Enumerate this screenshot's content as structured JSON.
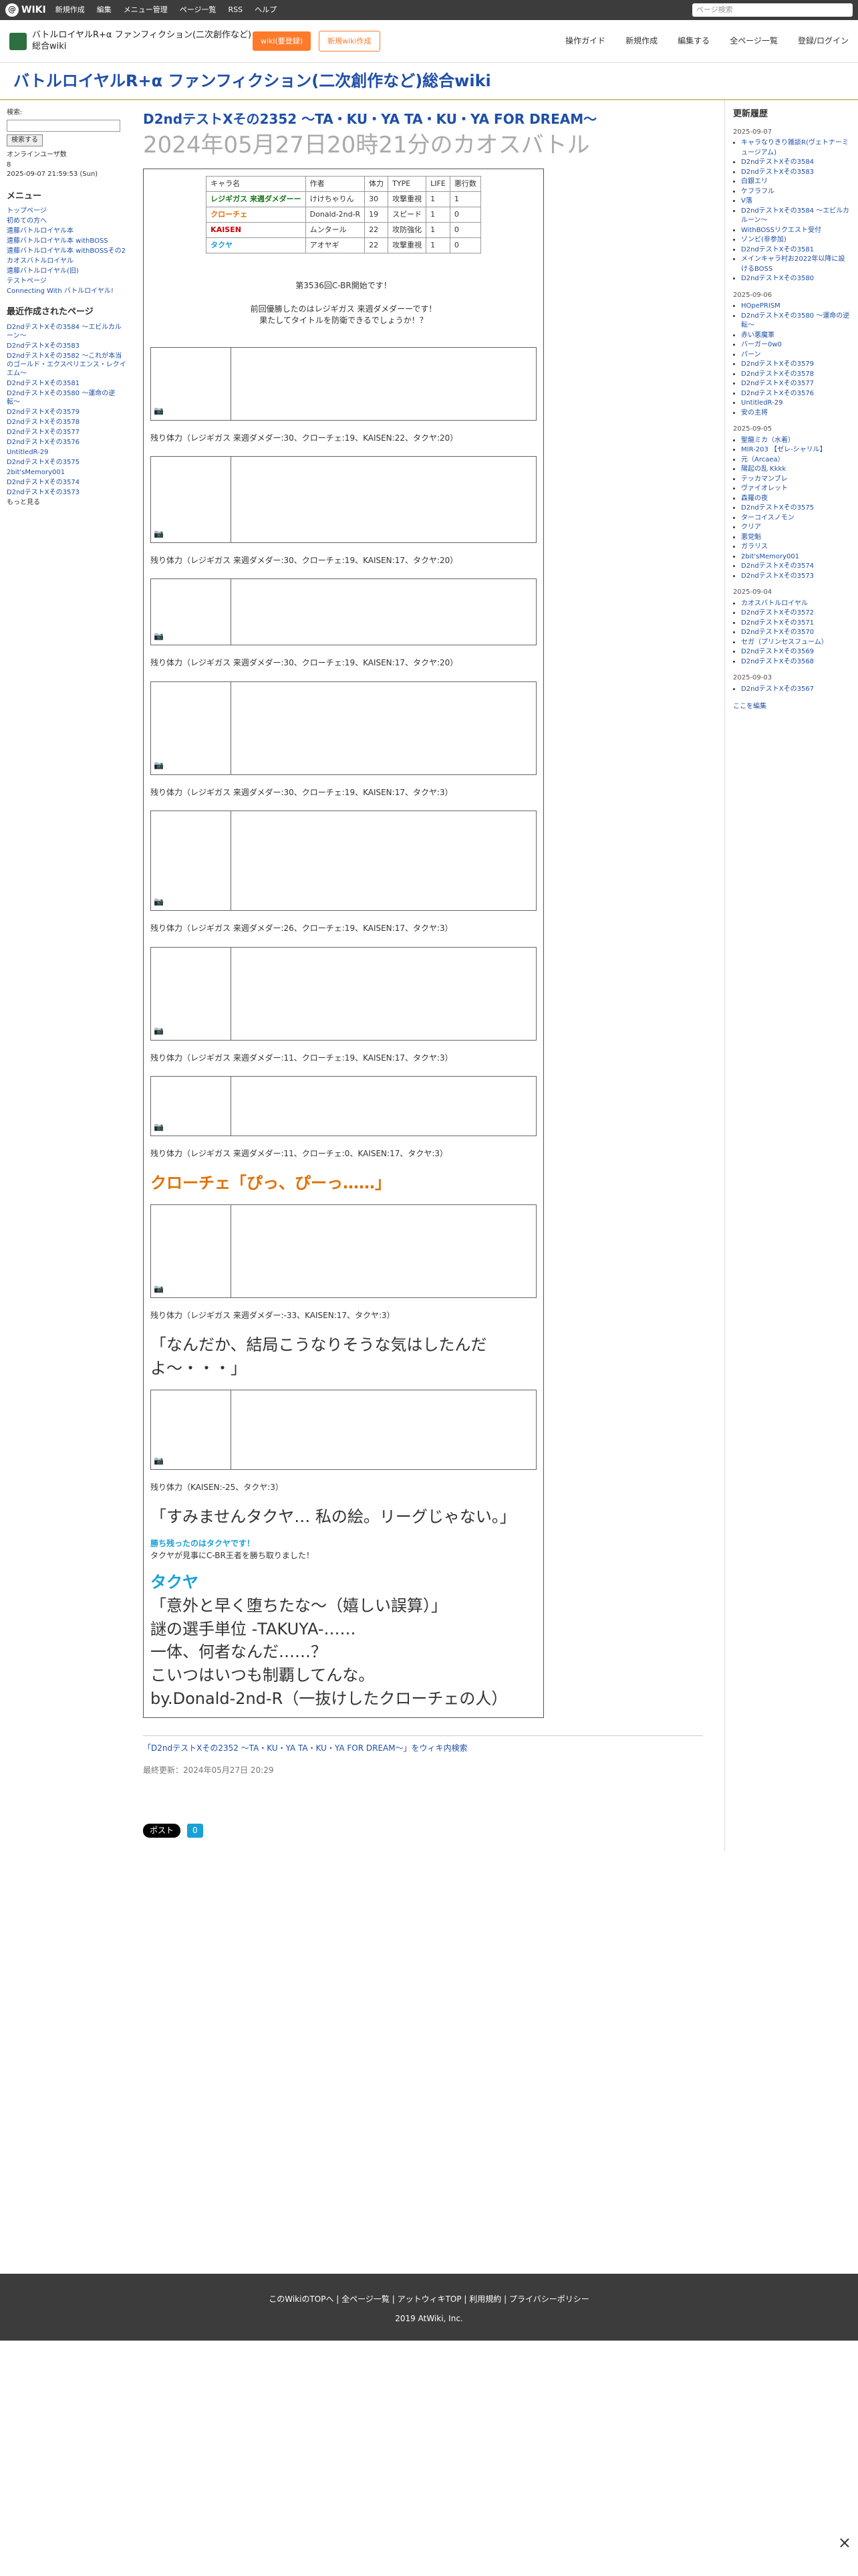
{
  "topbar": {
    "brand": "WIKI",
    "menu": [
      "新規作成",
      "編集",
      "メニュー管理",
      "ページ一覧",
      "RSS",
      "ヘルプ"
    ],
    "search_placeholder": "ページ検索"
  },
  "header": {
    "title": "バトルロイヤルR+α ファンフィクション(二次創作など)総合wiki",
    "btn_wiki": "wiki(要登録)",
    "btn_signup": "新規wiki作成",
    "nav": [
      "操作ガイド",
      "新規作成",
      "編集する",
      "全ページ一覧",
      "登録/ログイン"
    ]
  },
  "site_title": "バトルロイヤルR+α ファンフィクション(二次創作など)総合wiki",
  "left": {
    "search_label": "検索:",
    "search_btn": "検索する",
    "online_label": "オンラインユーザ数",
    "online_count": "8",
    "date": "2025-09-07 21:59:53 (Sun)",
    "menu_title": "メニュー",
    "menu": [
      "トップページ",
      "初めての方へ",
      "遠藤バトルロイヤル本",
      "遠藤バトルロイヤル本 withBOSS",
      "遠藤バトルロイヤル本 withBOSSその2",
      "カオスバトルロイヤル",
      "遠藤バトルロイヤル(旧)",
      "テストページ",
      "Connecting With バトルロイヤル!"
    ],
    "recent_title": "最近作成されたページ",
    "recent": [
      "D2ndテストXその3584 〜エビルカルーン〜",
      "D2ndテストXその3583",
      "D2ndテストXその3582 〜これが本当のゴールド・エクスペリエンス・レクイエム〜",
      "D2ndテストXその3581",
      "D2ndテストXその3580 〜運命の逆転〜",
      "D2ndテストXその3579",
      "D2ndテストXその3578",
      "D2ndテストXその3577",
      "D2ndテストXその3576",
      "UntitledR-29",
      "D2ndテストXその3575",
      "2bit'sMemory001",
      "D2ndテストXその3574",
      "D2ndテストXその3573"
    ],
    "more": "もっと見る"
  },
  "main": {
    "title": "D2ndテストXその2352 〜TA・KU・YA TA・KU・YA FOR DREAM〜",
    "datetime": "2024年05月27日20時21分のカオスバトル",
    "char_table": {
      "headers": [
        "キャラ名",
        "作者",
        "体力",
        "TYPE",
        "LIFE",
        "悪行数"
      ],
      "rows": [
        [
          "レジギガス 来週ダメダーー",
          "けけちゃりん",
          "30",
          "攻撃重視",
          "1",
          "1"
        ],
        [
          "クローチェ",
          "Donald-2nd-R",
          "19",
          "スピード",
          "1",
          "0"
        ],
        [
          "KAISEN",
          "ムンタール",
          "22",
          "攻防強化",
          "1",
          "0"
        ],
        [
          "タクヤ",
          "アオヤギ",
          "22",
          "攻撃重視",
          "1",
          "0"
        ]
      ]
    },
    "intro": [
      "第3536回C-BR開始です！",
      "前回優勝したのはレジギガス 来週ダメダーーです！",
      "果たしてタイトルを防衛できるでしょうか！？"
    ],
    "rem1": "残り体力（レジギガス 来週ダメダー:30、クローチェ:19、KAISEN:22、タクヤ:20）",
    "rem2": "残り体力（レジギガス 来週ダメダー:30、クローチェ:19、KAISEN:17、タクヤ:20）",
    "rem3": "残り体力（レジギガス 来週ダメダー:30、クローチェ:19、KAISEN:17、タクヤ:20）",
    "rem4": "残り体力（レジギガス 来週ダメダー:30、クローチェ:19、KAISEN:17、タクヤ:3）",
    "rem5": "残り体力（レジギガス 来週ダメダー:26、クローチェ:19、KAISEN:17、タクヤ:3）",
    "rem6": "残り体力（レジギガス 来週ダメダー:11、クローチェ:19、KAISEN:17、タクヤ:3）",
    "rem7": "残り体力（レジギガス 来週ダメダー:11、クローチェ:0、KAISEN:17、タクヤ:3）",
    "big1": "クローチェ「ぴっ、ぴーっ……」",
    "rem8": "残り体力（レジギガス 来週ダメダー:-33、KAISEN:17、タクヤ:3）",
    "big2": "「なんだか、結局こうなりそうな気はしたんだよ〜・・・」",
    "rem9": "残り体力（KAISEN:-25、タクヤ:3）",
    "big3": "「すみませんタクヤ… 私の絵。リーグじゃない。」",
    "winner": "勝ち残ったのはタクヤです！",
    "champ": "タクヤが見事にC-BR王者を勝ち取りました！",
    "ending": [
      "タクヤ",
      "「意外と早く堕ちたな〜（嬉しい誤算）」",
      "謎の選手単位 -TAKUYA-……",
      "一体、何者なんだ……？",
      "こいつはいつも制覇してんな。",
      "by.Donald-2nd-R（一抜けしたクローチェの人）"
    ],
    "wiki_link": "「D2ndテストXその2352 〜TA・KU・YA TA・KU・YA FOR DREAM〜」をウィキ内検索",
    "updated": "最終更新：2024年05月27日 20:29"
  },
  "right": {
    "title": "更新履歴",
    "groups": [
      {
        "date": "2025-09-07",
        "items": [
          "キャラなりきり雑談R(ヴェトナーミュージアム)",
          "D2ndテストXその3584",
          "D2ndテストXその3583",
          "白銀エリ",
          "ケフラフル",
          "V落",
          "D2ndテストXその3584 〜エビルカルーン〜",
          "WithBOSSリクエスト受付",
          "ゾンビ(非参加)",
          "D2ndテストXその3581",
          "メインキャラ村お2022年以降に設けるBOSS",
          "D2ndテストXその3580"
        ]
      },
      {
        "date": "2025-09-06",
        "items": [
          "HOpePRISM",
          "D2ndテストXその3580 〜運命の逆転〜",
          "赤い悪魔軍",
          "バーガー0w0",
          "パーン",
          "D2ndテストXその3579",
          "D2ndテストXその3578",
          "D2ndテストXその3577",
          "D2ndテストXその3576",
          "UntitledR-29",
          "安の主将"
        ]
      },
      {
        "date": "2025-09-05",
        "items": [
          "聖龍ミカ（水着）",
          "MIR-203 【ゼレ-シャリル】",
          "元（Arcaea）",
          "陽起の乱 Kkkk",
          "テッカマンブレ",
          "ヴァイオレット",
          "森羅の夜",
          "D2ndテストXその3575",
          "ターコイスノモン",
          "クリア",
          "悪党魁",
          "ガラリス",
          "2bit'sMemory001",
          "D2ndテストXその3574",
          "D2ndテストXその3573"
        ]
      },
      {
        "date": "2025-09-04",
        "items": [
          "カオスバトルロイヤル",
          "D2ndテストXその3572",
          "D2ndテストXその3571",
          "D2ndテストXその3570",
          "セガ（プリンセスフューム）",
          "D2ndテストXその3569",
          "D2ndテストXその3568"
        ]
      },
      {
        "date": "2025-09-03",
        "items": [
          "D2ndテストXその3567"
        ]
      }
    ],
    "more": "ここを編集"
  },
  "share": {
    "tweet": "ポスト",
    "like": "0"
  },
  "footer": {
    "links": [
      "このWikiのTOPへ",
      "全ページ一覧",
      "アットウィキTOP",
      "利用規約",
      "プライバシーポリシー"
    ],
    "copyright": "2019 AtWiki, Inc."
  }
}
